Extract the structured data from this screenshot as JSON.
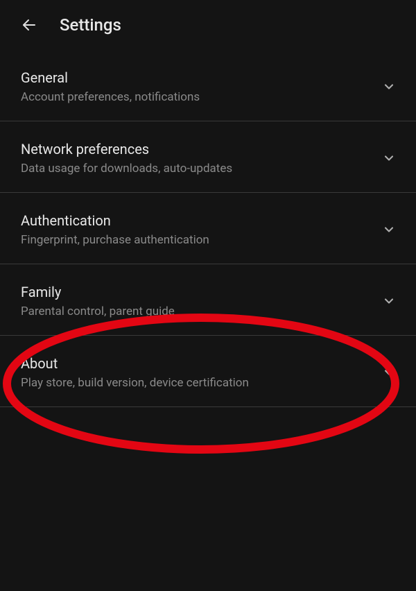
{
  "header": {
    "title": "Settings"
  },
  "items": [
    {
      "title": "General",
      "subtitle": "Account preferences, notifications"
    },
    {
      "title": "Network preferences",
      "subtitle": "Data usage for downloads, auto-updates"
    },
    {
      "title": "Authentication",
      "subtitle": "Fingerprint, purchase authentication"
    },
    {
      "title": "Family",
      "subtitle": "Parental control, parent guide"
    },
    {
      "title": "About",
      "subtitle": "Play store, build version, device certification"
    }
  ],
  "annotation": {
    "color": "#e30613",
    "highlightIndex": 3
  }
}
